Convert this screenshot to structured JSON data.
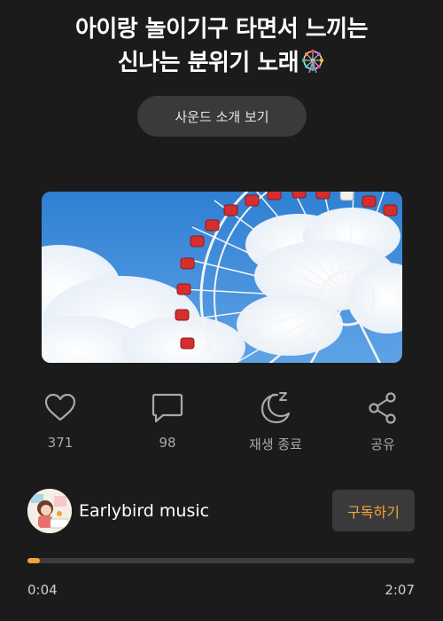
{
  "title": {
    "line1": "아이랑 놀이기구 타면서 느끼는",
    "line2": "신나는 분위기 노래",
    "emoji_icon": "ferris-wheel-emoji"
  },
  "intro_button": {
    "label": "사운드 소개 보기"
  },
  "artwork": {
    "icon": "ferris-wheel-photo"
  },
  "actions": [
    {
      "icon": "heart-icon",
      "label": "371"
    },
    {
      "icon": "comment-icon",
      "label": "98"
    },
    {
      "icon": "sleep-moon-icon",
      "label": "재생 종료"
    },
    {
      "icon": "share-icon",
      "label": "공유"
    }
  ],
  "channel": {
    "name": "Earlybird music",
    "avatar_icon": "channel-avatar",
    "subscribe_label": "구독하기"
  },
  "player": {
    "current_time": "0:04",
    "total_time": "2:07",
    "progress": 0.032
  },
  "colors": {
    "background": "#1b1b1b",
    "accent": "#f2a33a",
    "button_bg": "#3a3a3a",
    "muted_text": "#a9a9a9"
  }
}
